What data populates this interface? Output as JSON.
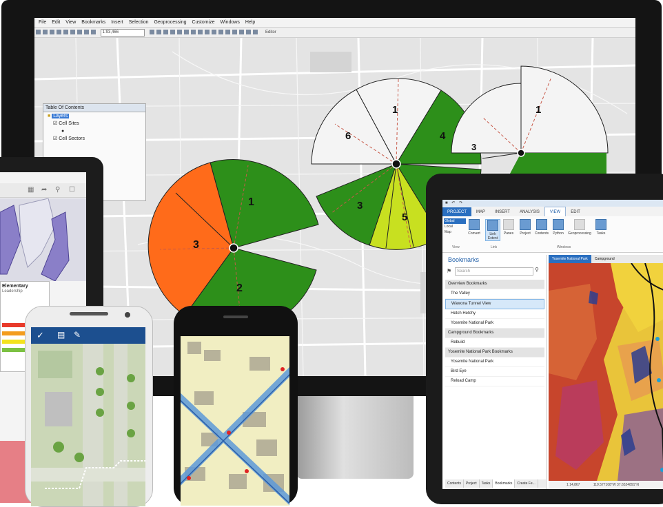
{
  "colors": {
    "sector_green": "#2d8f1a",
    "sector_orange": "#ff6b1a",
    "sector_lime": "#c8e020",
    "sector_lightgreen": "#7bc21c",
    "pro_blue": "#2a6fc0"
  },
  "desktop": {
    "menu": [
      "File",
      "Edit",
      "View",
      "Bookmarks",
      "Insert",
      "Selection",
      "Geoprocessing",
      "Customize",
      "Windows",
      "Help"
    ],
    "scale": "1:93,466",
    "editor_label": "Editor",
    "toc": {
      "title": "Table Of Contents",
      "items": [
        "Layers",
        "Cell Sites",
        "Cell Sectors"
      ]
    },
    "sector_labels": [
      "1",
      "2",
      "3",
      "1",
      "3",
      "4",
      "5",
      "6",
      "1",
      "3"
    ]
  },
  "tablet_left": {
    "status": "",
    "popup_title": "Elementary",
    "popup_sub": "Leadership"
  },
  "arcgis_pro": {
    "tabs": [
      "PROJECT",
      "MAP",
      "INSERT",
      "ANALYSIS",
      "VIEW",
      "EDIT"
    ],
    "ribbon": {
      "buttons": [
        "Global",
        "Local",
        "Map",
        "Convert",
        "Link Extent",
        "Panes",
        "Project",
        "Contents",
        "Python",
        "Geoprocessing",
        "Tasks"
      ],
      "groups": [
        "View",
        "Link",
        "Windows"
      ]
    },
    "bookmarks": {
      "title": "Bookmarks",
      "search_placeholder": "Search",
      "rows": [
        {
          "text": "Overview Bookmarks",
          "type": "header"
        },
        {
          "text": "The Valley",
          "type": "item"
        },
        {
          "text": "Wawona Tunnel View",
          "type": "selected"
        },
        {
          "text": "Hetch Hetchy",
          "type": "item"
        },
        {
          "text": "Yosemite National Park",
          "type": "item"
        },
        {
          "text": "Campground Bookmarks",
          "type": "header"
        },
        {
          "text": "Rebuild",
          "type": "item"
        },
        {
          "text": "Yosemite National Park Bookmarks",
          "type": "header"
        },
        {
          "text": "Yosemite National Park",
          "type": "item"
        },
        {
          "text": "Bird Eye",
          "type": "item"
        },
        {
          "text": "Reload Camp",
          "type": "item"
        }
      ],
      "bottom_tabs": [
        "Contents",
        "Project",
        "Tasks",
        "Bookmarks",
        "Create Fe..."
      ]
    },
    "map_tabs": [
      "Yosemite National Park",
      "Campground"
    ],
    "status": {
      "scale": "1:14,867",
      "coords": "119.577108°W 37.6524891°N"
    }
  }
}
